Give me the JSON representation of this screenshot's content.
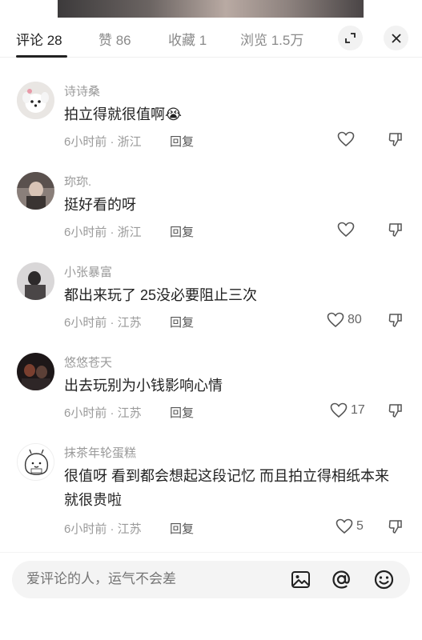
{
  "tabs": [
    {
      "label": "评论 28"
    },
    {
      "label": "赞 86"
    },
    {
      "label": "收藏 1"
    },
    {
      "label": "浏览 1.5万"
    }
  ],
  "comments": [
    {
      "name": "诗诗桑",
      "text": "拍立得就很值啊😭",
      "meta": "6小时前 · 浙江",
      "reply": "回复",
      "likes": ""
    },
    {
      "name": "珎珎.",
      "text": "挺好看的呀",
      "meta": "6小时前 · 浙江",
      "reply": "回复",
      "likes": ""
    },
    {
      "name": "小张暴富",
      "text": "都出来玩了  25没必要阻止三次",
      "meta": "6小时前 · 江苏",
      "reply": "回复",
      "likes": "80"
    },
    {
      "name": "悠悠苍天",
      "text": "出去玩别为小钱影响心情",
      "meta": "6小时前 · 江苏",
      "reply": "回复",
      "likes": "17"
    },
    {
      "name": "抹茶年轮蛋糕",
      "text": "很值呀 看到都会想起这段记忆 而且拍立得相纸本来就很贵啦",
      "meta": "6小时前 · 江苏",
      "reply": "回复",
      "likes": "5"
    }
  ],
  "input": {
    "placeholder": "爱评论的人，运气不会差"
  },
  "icons": {
    "expand": "expand-icon",
    "close": "close-icon",
    "like": "heart-icon",
    "dislike": "thumb-down-icon",
    "image": "image-icon",
    "mention": "at-icon",
    "emoji": "emoji-icon"
  }
}
